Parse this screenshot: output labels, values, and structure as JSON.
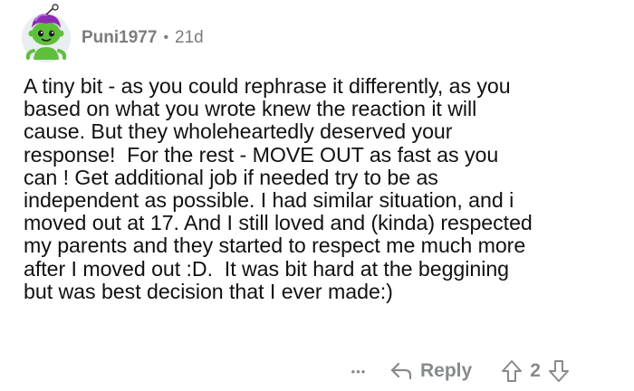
{
  "comment": {
    "username": "Puni1977",
    "separator": "•",
    "age": "21d",
    "body": "A tiny bit - as you could rephrase it differently, as you\nbased on what you wrote knew the reaction it will\ncause. But they wholeheartedly deserved your\nresponse!  For the rest - MOVE OUT as fast as you\ncan ! Get additional job if needed try to be as\nindependent as possible. I had similar situation, and i\nmoved out at 17. And I still loved and (kinda) respected\nmy parents and they started to respect me much more\nafter I moved out :D.  It was bit hard at the beggining\nbut was best decision that I ever made:)",
    "actions": {
      "more_label": "•••",
      "reply_label": "Reply",
      "vote_count": "2"
    }
  },
  "icons": {
    "avatar": "avatar-icon",
    "more": "more-options-icon",
    "reply": "reply-arrow-icon",
    "upvote": "upvote-arrow-icon",
    "downvote": "downvote-arrow-icon"
  },
  "colors": {
    "meta_text": "#7c7c7c",
    "action_text": "#878a8c",
    "body_text": "#111111",
    "avatar_green": "#5fbf3b",
    "avatar_hair": "#8e2bb5",
    "avatar_bg": "#e9eef0"
  }
}
